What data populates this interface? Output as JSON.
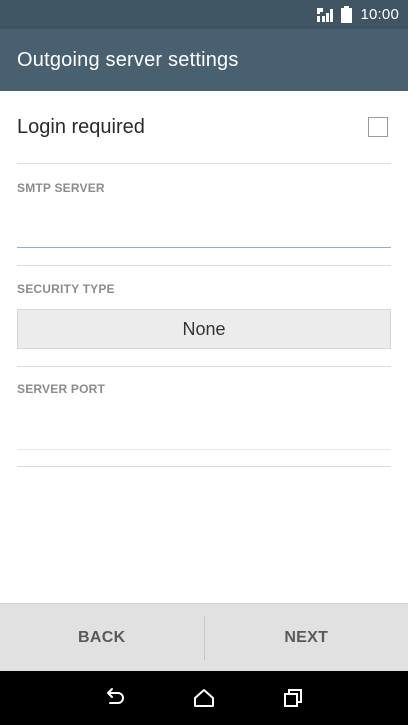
{
  "status_bar": {
    "time": "10:00",
    "icons": [
      "signal-icon",
      "battery-icon"
    ]
  },
  "app_bar": {
    "title": "Outgoing server settings"
  },
  "form": {
    "login_required": {
      "label": "Login required",
      "checked": false
    },
    "smtp_server": {
      "label": "SMTP SERVER",
      "value": "",
      "placeholder": ""
    },
    "security_type": {
      "label": "SECURITY TYPE",
      "selected": "None"
    },
    "server_port": {
      "label": "SERVER PORT",
      "value": "",
      "placeholder": ""
    }
  },
  "actions": {
    "back_label": "BACK",
    "next_label": "NEXT"
  },
  "nav_bar": {
    "icons": [
      "back-icon",
      "home-icon",
      "recents-icon"
    ]
  },
  "colors": {
    "status_bar": "#3f5563",
    "app_bar": "#48606f",
    "active_underline": "#87b3c3",
    "button_bar": "#e1e1e1"
  }
}
